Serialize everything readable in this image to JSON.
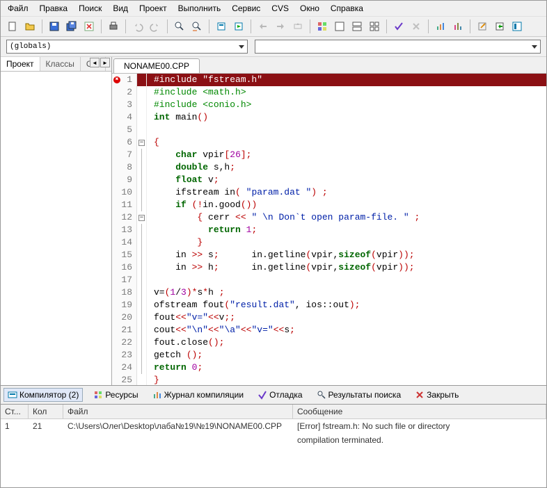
{
  "menu": [
    "Файл",
    "Правка",
    "Поиск",
    "Вид",
    "Проект",
    "Выполнить",
    "Сервис",
    "CVS",
    "Окно",
    "Справка"
  ],
  "globals": "(globals)",
  "sidebar_tabs": [
    "Проект",
    "Классы",
    "О..."
  ],
  "editor_tab": "NONAME00.CPP",
  "code_lines": [
    {
      "n": 1,
      "err": true,
      "hl": true,
      "html": "#include \"fstream.h\""
    },
    {
      "n": 2,
      "html": "<span class='pre'>#include &lt;math.h&gt;</span>"
    },
    {
      "n": 3,
      "html": "<span class='pre'>#include &lt;conio.h&gt;</span>"
    },
    {
      "n": 4,
      "html": "<span class='kw'>int</span> main<span class='pnc'>()</span>"
    },
    {
      "n": 5,
      "html": ""
    },
    {
      "n": 6,
      "fold": "-",
      "html": "<span class='pnc'>{</span>"
    },
    {
      "n": 7,
      "html": "    <span class='kw'>char</span> vpir<span class='pnc'>[</span><span class='num'>26</span><span class='pnc'>];</span>"
    },
    {
      "n": 8,
      "html": "    <span class='kw'>double</span> s,h<span class='pnc'>;</span>"
    },
    {
      "n": 9,
      "html": "    <span class='kw'>float</span> v<span class='pnc'>;</span>"
    },
    {
      "n": 10,
      "html": "    ifstream in<span class='pnc'>(</span> <span class='str'>\"param.dat \"</span><span class='pnc'>) ;</span>"
    },
    {
      "n": 11,
      "html": "    <span class='kw'>if</span> <span class='pnc'>(!</span>in.good<span class='pnc'>())</span>"
    },
    {
      "n": 12,
      "fold": "-",
      "html": "        <span class='pnc'>{</span> cerr <span class='pnc'>&lt;&lt;</span> <span class='str'>\" \\n Don`t open param-file. \"</span> <span class='pnc'>;</span>"
    },
    {
      "n": 13,
      "html": "          <span class='kw'>return</span> <span class='num'>1</span><span class='pnc'>;</span>"
    },
    {
      "n": 14,
      "html": "        <span class='pnc'>}</span>"
    },
    {
      "n": 15,
      "html": "    in <span class='pnc'>&gt;&gt;</span> s<span class='pnc'>;</span>      in.getline<span class='pnc'>(</span>vpir,<span class='kw'>sizeof</span><span class='pnc'>(</span>vpir<span class='pnc'>));</span>"
    },
    {
      "n": 16,
      "html": "    in <span class='pnc'>&gt;&gt;</span> h<span class='pnc'>;</span>      in.getline<span class='pnc'>(</span>vpir,<span class='kw'>sizeof</span><span class='pnc'>(</span>vpir<span class='pnc'>));</span>"
    },
    {
      "n": 17,
      "html": ""
    },
    {
      "n": 18,
      "html": "v=<span class='pnc'>(</span><span class='num'>1</span>/<span class='num'>3</span><span class='pnc'>)*</span>s<span class='pnc'>*</span>h <span class='pnc'>;</span>"
    },
    {
      "n": 19,
      "html": "ofstream fout<span class='pnc'>(</span><span class='str'>\"result.dat\"</span>, ios::out<span class='pnc'>);</span>"
    },
    {
      "n": 20,
      "html": "fout<span class='pnc'>&lt;&lt;</span><span class='str'>\"v=\"</span><span class='pnc'>&lt;&lt;</span>v<span class='pnc'>;;</span>"
    },
    {
      "n": 21,
      "html": "cout<span class='pnc'>&lt;&lt;</span><span class='str'>\"\\n\"</span><span class='pnc'>&lt;&lt;</span><span class='str'>\"\\a\"</span><span class='pnc'>&lt;&lt;</span><span class='str'>\"v=\"</span><span class='pnc'>&lt;&lt;</span>s<span class='pnc'>;</span>"
    },
    {
      "n": 22,
      "html": "fout.close<span class='pnc'>();</span>"
    },
    {
      "n": 23,
      "html": "getch <span class='pnc'>();</span>"
    },
    {
      "n": 24,
      "html": "<span class='kw'>return</span> <span class='num'>0</span><span class='pnc'>;</span>"
    },
    {
      "n": 25,
      "html": "<span class='pnc'>}</span>"
    }
  ],
  "bottom_tabs": {
    "compiler": "Компилятор (2)",
    "resources": "Ресурсы",
    "log": "Журнал компиляции",
    "debug": "Отладка",
    "search": "Результаты поиска",
    "close": "Закрыть"
  },
  "msg_head": {
    "line": "Ст...",
    "col": "Кол",
    "file": "Файл",
    "msg": "Сообщение"
  },
  "messages": [
    {
      "line": "1",
      "col": "21",
      "file": "C:\\Users\\Олег\\Desktop\\лаба№19\\№19\\NONAME00.CPP",
      "msg": "[Error] fstream.h: No such file or directory"
    },
    {
      "line": "",
      "col": "",
      "file": "",
      "msg": "compilation terminated."
    }
  ]
}
